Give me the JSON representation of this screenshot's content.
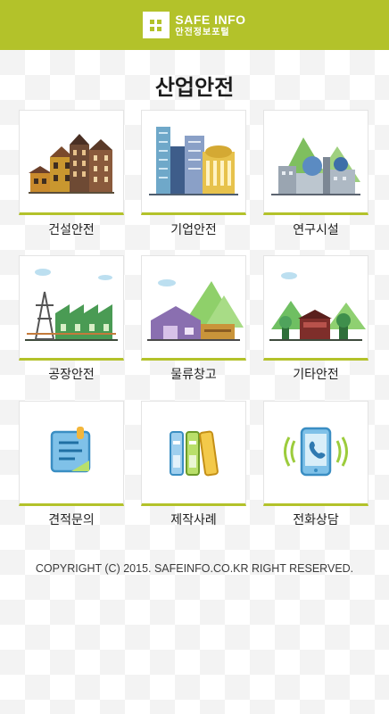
{
  "header": {
    "brand_en": "SAFE INFO",
    "brand_ko": "안전정보포털",
    "color": "#b3c22a"
  },
  "page": {
    "title": "산업안전"
  },
  "tiles": [
    {
      "label": "건설안전",
      "icon": "construction-buildings-illustration"
    },
    {
      "label": "기업안전",
      "icon": "corporate-city-illustration"
    },
    {
      "label": "연구시설",
      "icon": "research-facility-illustration"
    },
    {
      "label": "공장안전",
      "icon": "factory-illustration"
    },
    {
      "label": "물류창고",
      "icon": "warehouse-illustration"
    },
    {
      "label": "기타안전",
      "icon": "other-safety-illustration"
    },
    {
      "label": "견적문의",
      "icon": "quote-note-icon"
    },
    {
      "label": "제작사례",
      "icon": "binders-icon"
    },
    {
      "label": "전화상담",
      "icon": "phone-call-icon"
    }
  ],
  "footer": {
    "copyright": "COPYRIGHT (C) 2015. SAFEINFO.CO.KR RIGHT RESERVED."
  }
}
